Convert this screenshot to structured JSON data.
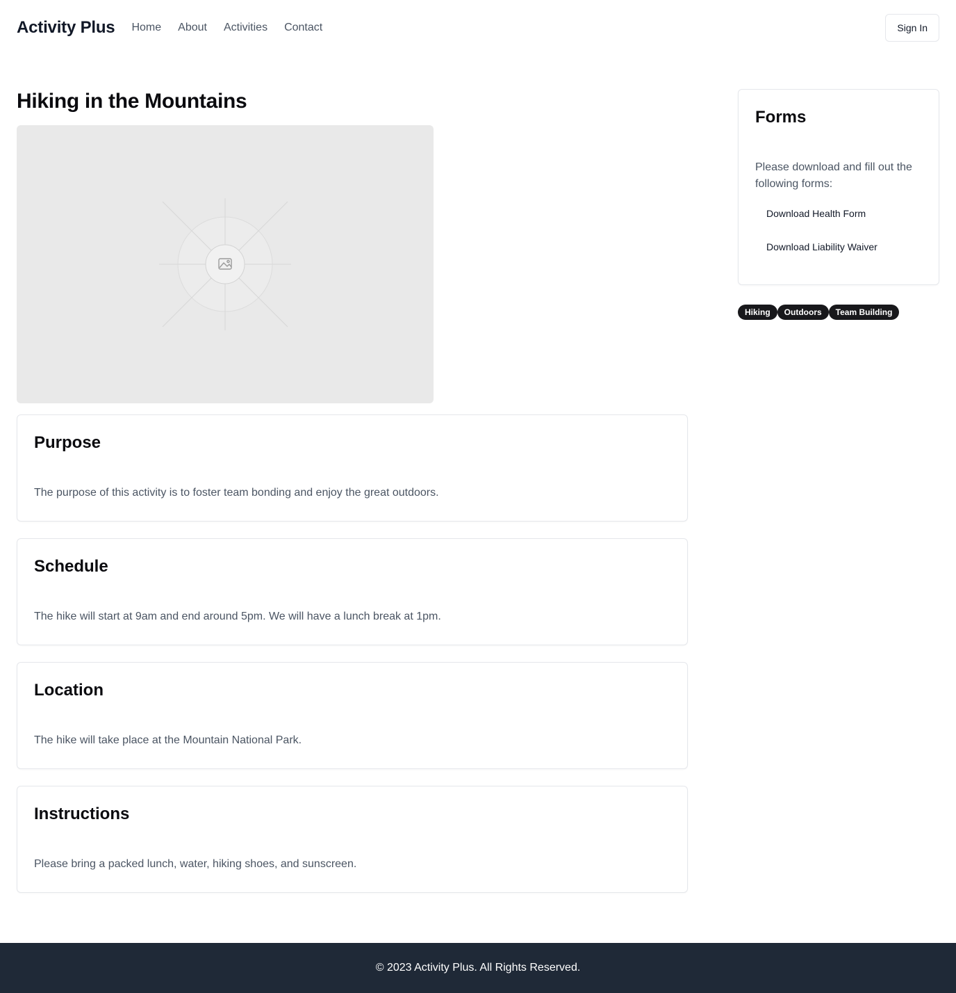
{
  "header": {
    "brand": "Activity Plus",
    "nav": [
      "Home",
      "About",
      "Activities",
      "Contact"
    ],
    "signin_label": "Sign In"
  },
  "main": {
    "title": "Hiking in the Mountains",
    "image_icon": "image-placeholder-icon",
    "sections": [
      {
        "heading": "Purpose",
        "body": "The purpose of this activity is to foster team bonding and enjoy the great outdoors."
      },
      {
        "heading": "Schedule",
        "body": "The hike will start at 9am and end around 5pm. We will have a lunch break at 1pm."
      },
      {
        "heading": "Location",
        "body": "The hike will take place at the Mountain National Park."
      },
      {
        "heading": "Instructions",
        "body": "Please bring a packed lunch, water, hiking shoes, and sunscreen."
      }
    ]
  },
  "sidebar": {
    "forms_title": "Forms",
    "forms_text": "Please download and fill out the following forms:",
    "downloads": [
      "Download Health Form",
      "Download Liability Waiver"
    ],
    "tags": [
      "Hiking",
      "Outdoors",
      "Team Building"
    ]
  },
  "footer": {
    "text": "© 2023 Activity Plus. All Rights Reserved."
  },
  "colors": {
    "footer_bg": "#1f2937",
    "tag_bg": "#18181b",
    "muted_text": "#4b5563",
    "border": "#e5e7eb"
  }
}
